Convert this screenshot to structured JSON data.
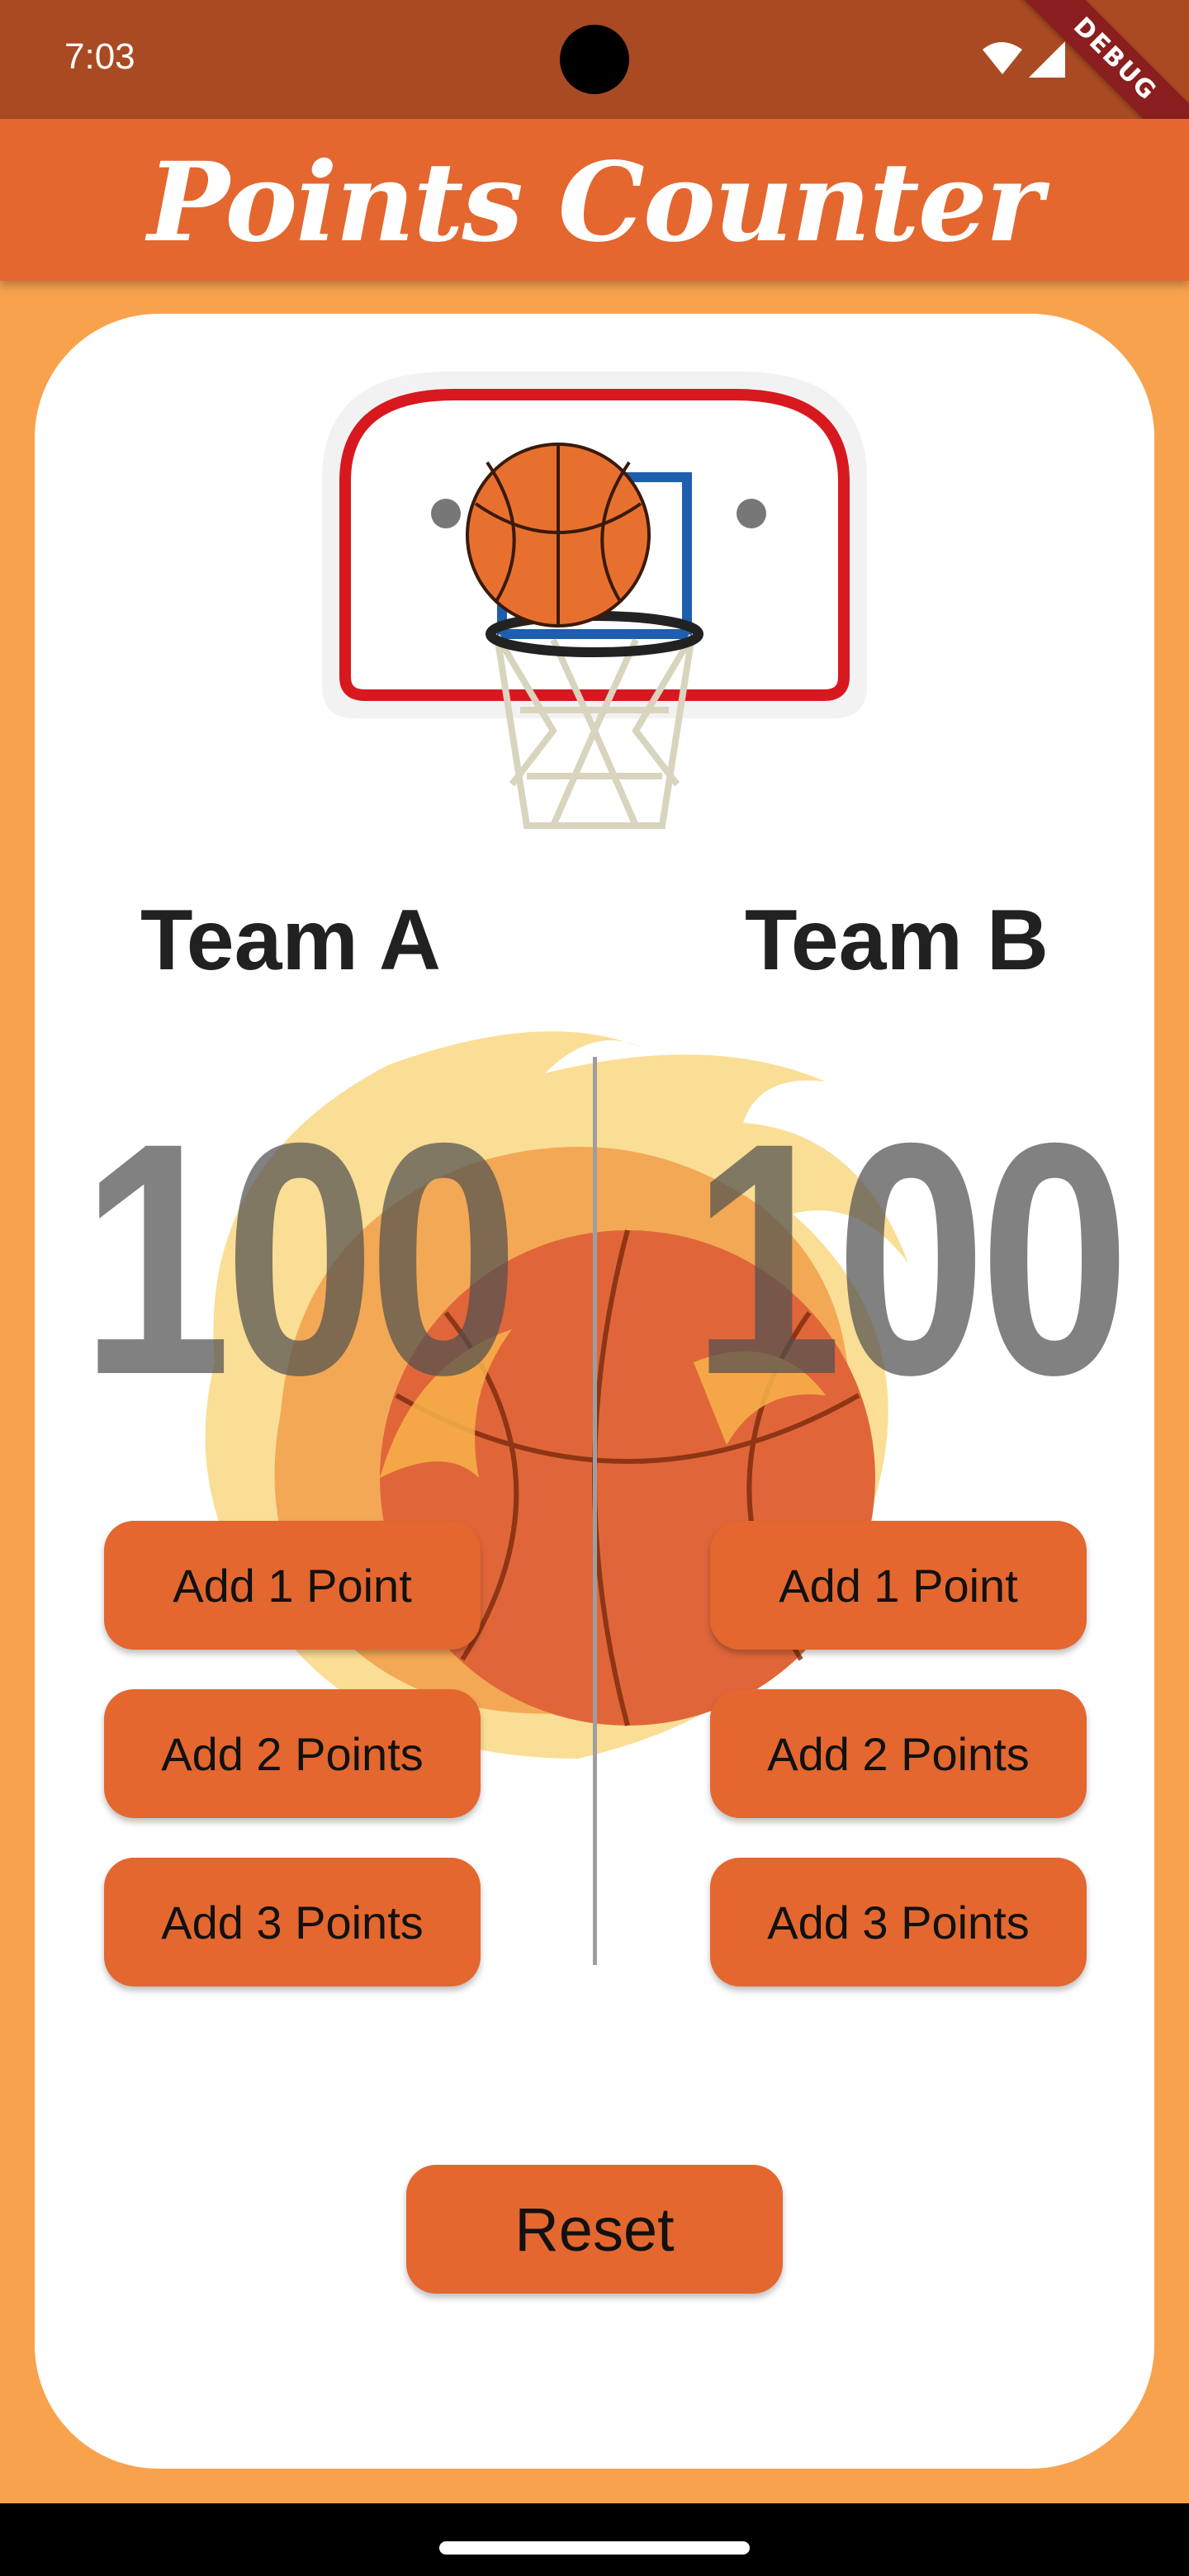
{
  "status_bar": {
    "time": "7:03",
    "debug_label": "DEBUG"
  },
  "app_bar": {
    "title": "Points Counter"
  },
  "team_a": {
    "name": "Team A",
    "score": "100",
    "buttons": [
      "Add 1 Point",
      "Add 2 Points",
      "Add 3 Points"
    ]
  },
  "team_b": {
    "name": "Team B",
    "score": "100",
    "buttons": [
      "Add 1 Point",
      "Add 2 Points",
      "Add 3 Points"
    ]
  },
  "reset_label": "Reset",
  "colors": {
    "status_bar": "#A94A23",
    "app_bar": "#E3672F",
    "background": "#F8A24E",
    "button": "#E3672F",
    "card": "#FFFFFF"
  },
  "icons": [
    "wifi-icon",
    "signal-icon",
    "basketball-hoop-image",
    "fire-basketball-image"
  ]
}
